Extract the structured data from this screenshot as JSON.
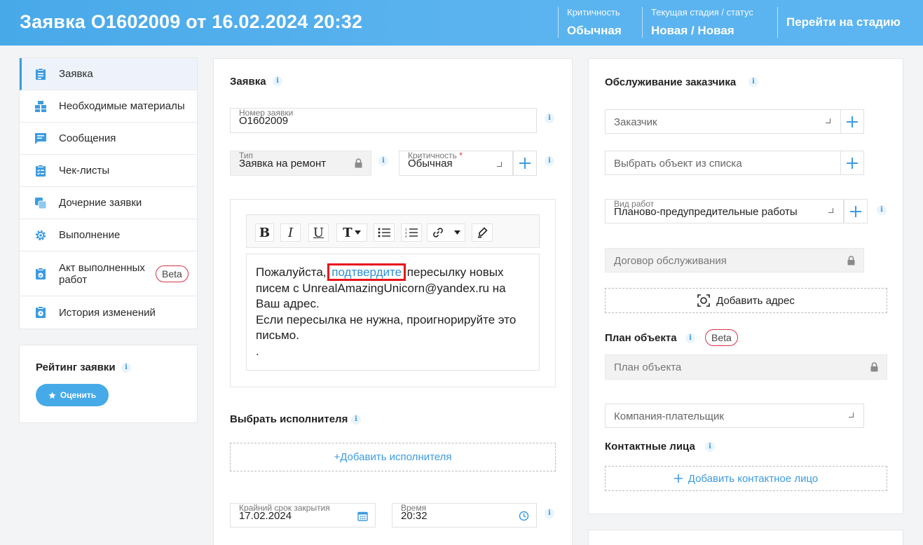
{
  "header": {
    "title": "Заявка О1602009 от 16.02.2024 20:32",
    "criticality_label": "Критичность",
    "criticality_value": "Обычная",
    "stage_label": "Текущая стадия / статус",
    "stage_value": "Новая / Новая",
    "go_to_stage": "Перейти на стадию"
  },
  "sidebar": {
    "items": [
      {
        "label": "Заявка",
        "icon": "clipboard-icon"
      },
      {
        "label": "Необходимые материалы",
        "icon": "boxes-icon"
      },
      {
        "label": "Сообщения",
        "icon": "message-icon"
      },
      {
        "label": "Чек-листы",
        "icon": "checklist-icon"
      },
      {
        "label": "Дочерние заявки",
        "icon": "child-requests-icon"
      },
      {
        "label": "Выполнение",
        "icon": "gear-icon"
      },
      {
        "label": "Акт выполненных работ",
        "label_line1": "Акт выполненных",
        "label_line2": "работ",
        "badge": "Beta",
        "icon": "act-icon"
      },
      {
        "label": "История изменений",
        "icon": "history-icon"
      }
    ]
  },
  "rating": {
    "title": "Рейтинг заявки",
    "button": "Оценить"
  },
  "request": {
    "section_title": "Заявка",
    "number_label": "Номер заявки",
    "number_value": "О1602009",
    "type_label": "Тип",
    "type_value": "Заявка на ремонт",
    "criticality_label": "Критичность",
    "criticality_required": "*",
    "criticality_value": "Обычная"
  },
  "editor": {
    "toolbar": [
      "B",
      "I",
      "U",
      "T",
      "bulleted-list",
      "numbered-list",
      "link",
      "pen"
    ],
    "text_before": "Пожалуйста,",
    "link_text": "подтвердите",
    "text_after": "пересылку новых писем с UnrealAmazingUnicorn@yandex.ru на Ваш адрес.",
    "line2": "Если пересылка не нужна, проигнорируйте это письмо.",
    "line3": "."
  },
  "executor": {
    "section_title": "Выбрать исполнителя",
    "add_button": "+Добавить исполнителя"
  },
  "deadline": {
    "date_label": "Крайний срок закрытия",
    "date_value": "17.02.2024",
    "time_label": "Время",
    "time_value": "20:32"
  },
  "service": {
    "section_title": "Обслуживание заказчика",
    "customer_placeholder": "Заказчик",
    "object_placeholder": "Выбрать объект из списка",
    "work_type_label": "Вид работ",
    "work_type_value": "Планово-предупредительные работы",
    "contract_placeholder": "Договор обслуживания",
    "add_address": "Добавить адрес",
    "plan_title": "План объекта",
    "plan_badge": "Beta",
    "plan_placeholder": "План объекта",
    "payer_placeholder": "Компания-плательщик",
    "contacts_title": "Контактные лица",
    "add_contact": "Добавить контактное лицо"
  },
  "colors": {
    "accent": "#3d9be0",
    "header": "#4aaae9",
    "highlight": "#e8131b",
    "badge_border": "#d9324a"
  }
}
